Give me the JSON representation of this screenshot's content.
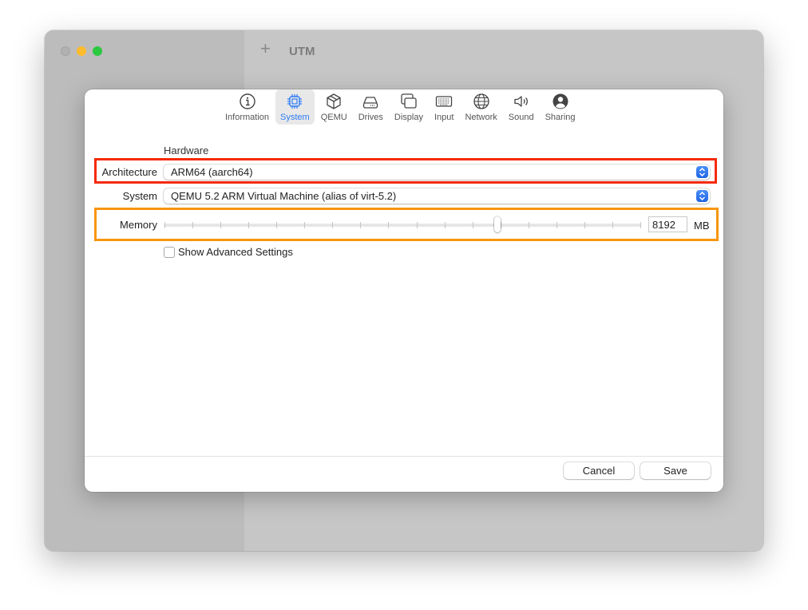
{
  "window": {
    "title": "UTM",
    "add_label": "+"
  },
  "toolbar": {
    "items": [
      {
        "label": "Information",
        "icon": "info-icon"
      },
      {
        "label": "System",
        "icon": "cpu-icon",
        "selected": true
      },
      {
        "label": "QEMU",
        "icon": "cube-icon"
      },
      {
        "label": "Drives",
        "icon": "drive-icon"
      },
      {
        "label": "Display",
        "icon": "display-icon"
      },
      {
        "label": "Input",
        "icon": "keyboard-icon"
      },
      {
        "label": "Network",
        "icon": "globe-icon"
      },
      {
        "label": "Sound",
        "icon": "speaker-icon"
      },
      {
        "label": "Sharing",
        "icon": "person-icon"
      }
    ],
    "accent_color": "#2f7cf6"
  },
  "form": {
    "section_header": "Hardware",
    "architecture": {
      "label": "Architecture",
      "value": "ARM64 (aarch64)"
    },
    "system": {
      "label": "System",
      "value": "QEMU 5.2 ARM Virtual Machine (alias of virt-5.2)"
    },
    "memory": {
      "label": "Memory",
      "value": "8192",
      "unit": "MB",
      "slider_fraction": 0.7,
      "tick_count": 18
    },
    "advanced": {
      "label": "Show Advanced Settings",
      "checked": false
    }
  },
  "highlights": {
    "architecture_color": "#f52a0a",
    "memory_color": "#f8960e"
  },
  "footer": {
    "cancel_label": "Cancel",
    "save_label": "Save"
  }
}
